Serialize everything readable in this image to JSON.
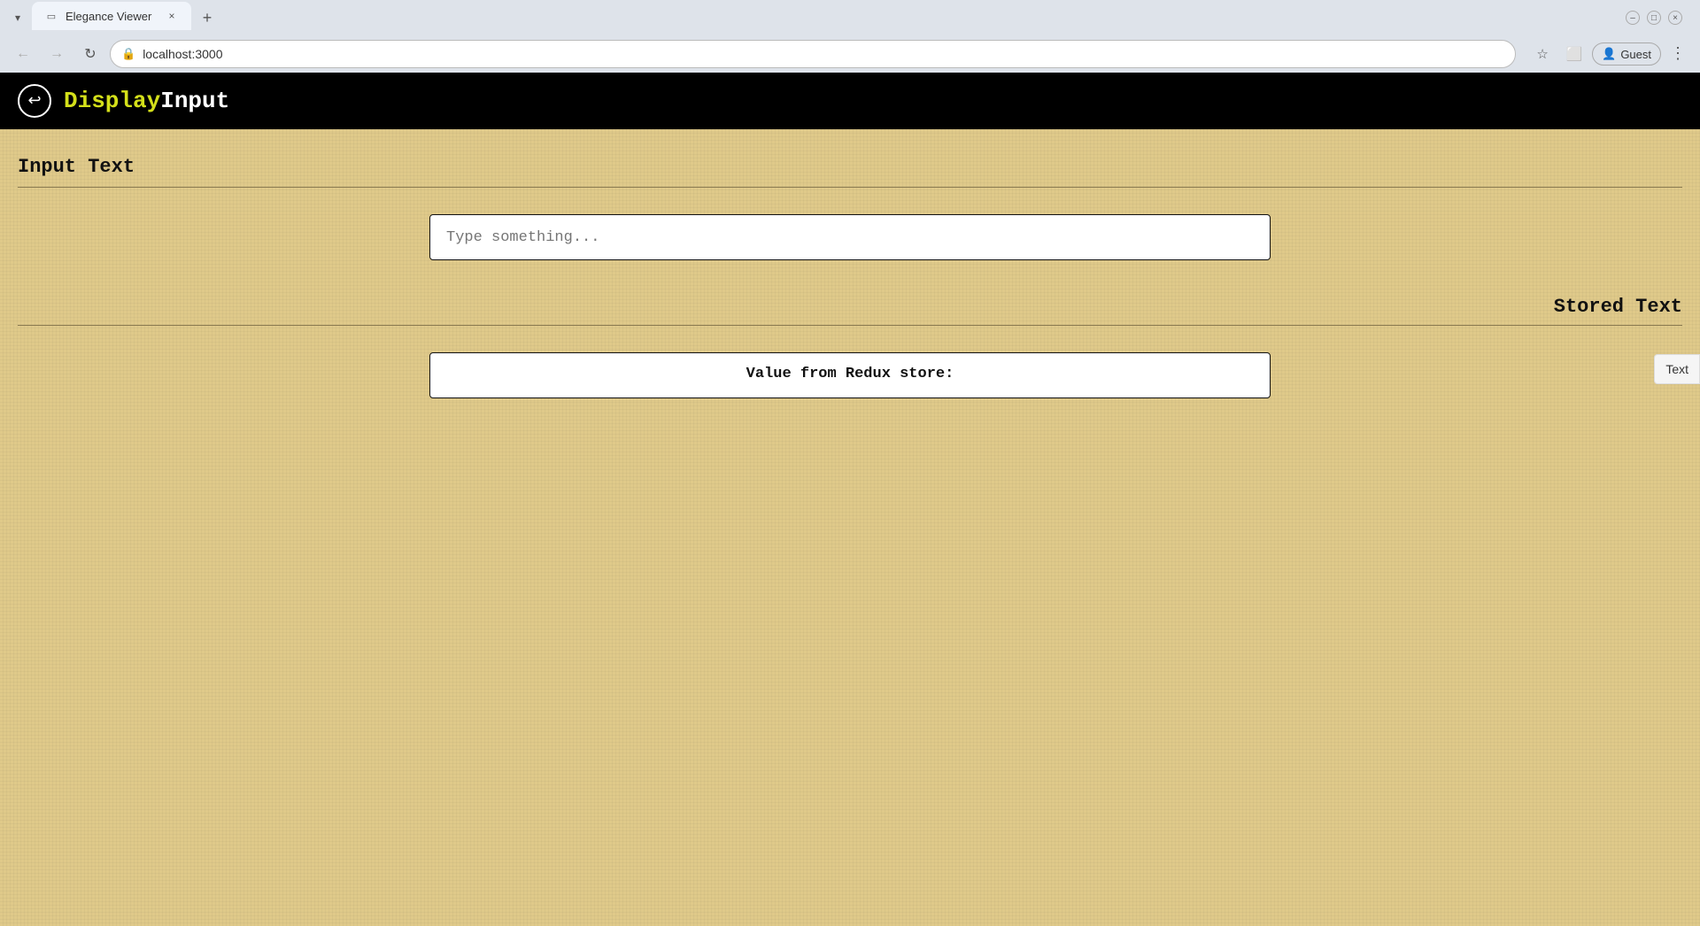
{
  "browser": {
    "tab_title": "Elegance Viewer",
    "address": "localhost:3000",
    "tab_dropdown_symbol": "▾",
    "new_tab_symbol": "+",
    "tab_close_symbol": "×",
    "back_symbol": "←",
    "forward_symbol": "→",
    "reload_symbol": "↻",
    "lock_symbol": "🔒",
    "guest_label": "Guest",
    "menu_symbol": "⋮",
    "star_symbol": "☆",
    "extensions_symbol": "⊞",
    "sidebar_symbol": "⬜"
  },
  "app": {
    "logo_symbol": "↩",
    "title_display": "Display",
    "title_input": "Input",
    "header": {
      "input_section_title": "Input Text",
      "stored_section_title": "Stored Text"
    },
    "input_placeholder": "Type something...",
    "input_value": "",
    "stored_label": "Value from Redux store:",
    "stored_value": ""
  },
  "side_panel": {
    "label": "Text"
  }
}
